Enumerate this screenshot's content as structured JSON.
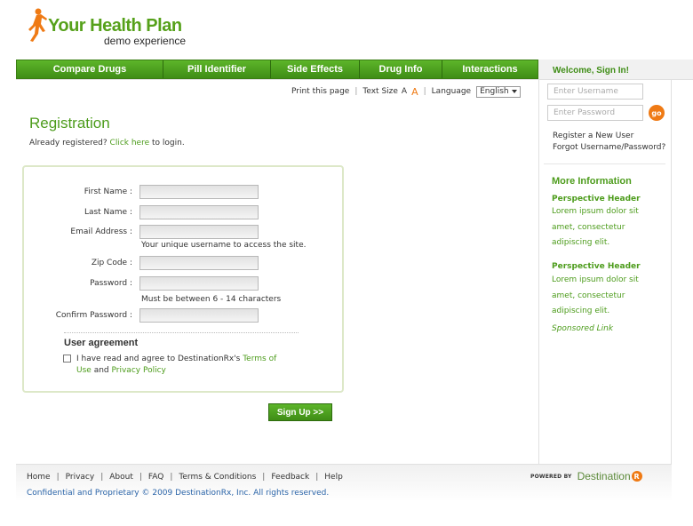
{
  "logo": {
    "title": "Your Health Plan",
    "subtitle": "demo experience"
  },
  "nav": {
    "items": [
      "Compare Drugs",
      "Pill Identifier",
      "Side Effects",
      "Drug Info",
      "Interactions"
    ],
    "welcome": "Welcome, Sign In!"
  },
  "tools": {
    "print": "Print this page",
    "text_size": "Text Size",
    "text_size_small": "A",
    "text_size_large": "A",
    "language_label": "Language",
    "language_value": "English"
  },
  "registration": {
    "title": "Registration",
    "already_prefix": "Already registered?",
    "click_here": "Click here",
    "already_suffix": "to login.",
    "fields": {
      "first_name": "First Name :",
      "last_name": "Last Name :",
      "email": "Email Address :",
      "email_hint": "Your unique username to access the site.",
      "zip": "Zip Code :",
      "password": "Password :",
      "password_hint": "Must be between 6 - 14 characters",
      "confirm": "Confirm Password :"
    },
    "agreement": {
      "title": "User agreement",
      "text_prefix": "I have read and agree to DestinationRx's",
      "terms_part1": "Terms of",
      "terms_part2": "Use",
      "and": "and",
      "privacy": "Privacy Policy"
    },
    "signup": "Sign Up >>"
  },
  "sidebar": {
    "username_placeholder": "Enter Username",
    "password_placeholder": "Enter Password",
    "go": "go",
    "register": "Register a New User",
    "forgot": "Forgot Username/Password?",
    "more_info": "More Information",
    "perspectives": [
      {
        "header": "Perspective Header",
        "body_lines": [
          "Lorem ipsum dolor sit",
          "amet, consectetur",
          "adipiscing elit."
        ]
      },
      {
        "header": "Perspective Header",
        "body_lines": [
          "Lorem ipsum dolor sit",
          "amet, consectetur",
          "adipiscing elit."
        ]
      }
    ],
    "sponsored": "Sponsored Link"
  },
  "footer": {
    "links": [
      "Home",
      "Privacy",
      "About",
      "FAQ",
      "Terms & Conditions",
      "Feedback",
      "Help"
    ],
    "copyright": "Confidential and Proprietary © 2009 DestinationRx, Inc. All rights reserved.",
    "powered_by": "POWERED BY",
    "brand": "Destination",
    "brand_badge": "R"
  },
  "colors": {
    "brand_green": "#4d9c1c",
    "accent_orange": "#ef7a14",
    "link_blue": "#2a64a8"
  },
  "icons": {
    "logo": "runner-icon",
    "language": "chevron-down-icon",
    "agree": "checkbox-icon"
  }
}
